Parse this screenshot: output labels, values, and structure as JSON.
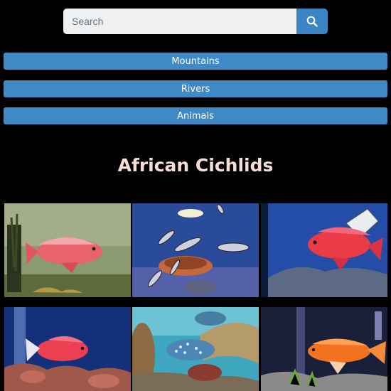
{
  "search": {
    "placeholder": "Search",
    "value": "",
    "icon": "search-icon"
  },
  "nav": [
    {
      "label": "Mountains"
    },
    {
      "label": "Rivers"
    },
    {
      "label": "Animals"
    }
  ],
  "page": {
    "title": "African Cichlids"
  },
  "colors": {
    "accent": "#3f8ac6",
    "title": "#f6ddd6",
    "background": "#000000"
  },
  "gallery": [
    {
      "subject": "red cichlid near plants"
    },
    {
      "subject": "school of striped cichlids"
    },
    {
      "subject": "red cichlid by sign"
    },
    {
      "subject": "red cichlid over rocks"
    },
    {
      "subject": "blue spotted cichlid in pot"
    },
    {
      "subject": "orange cichlid"
    }
  ]
}
